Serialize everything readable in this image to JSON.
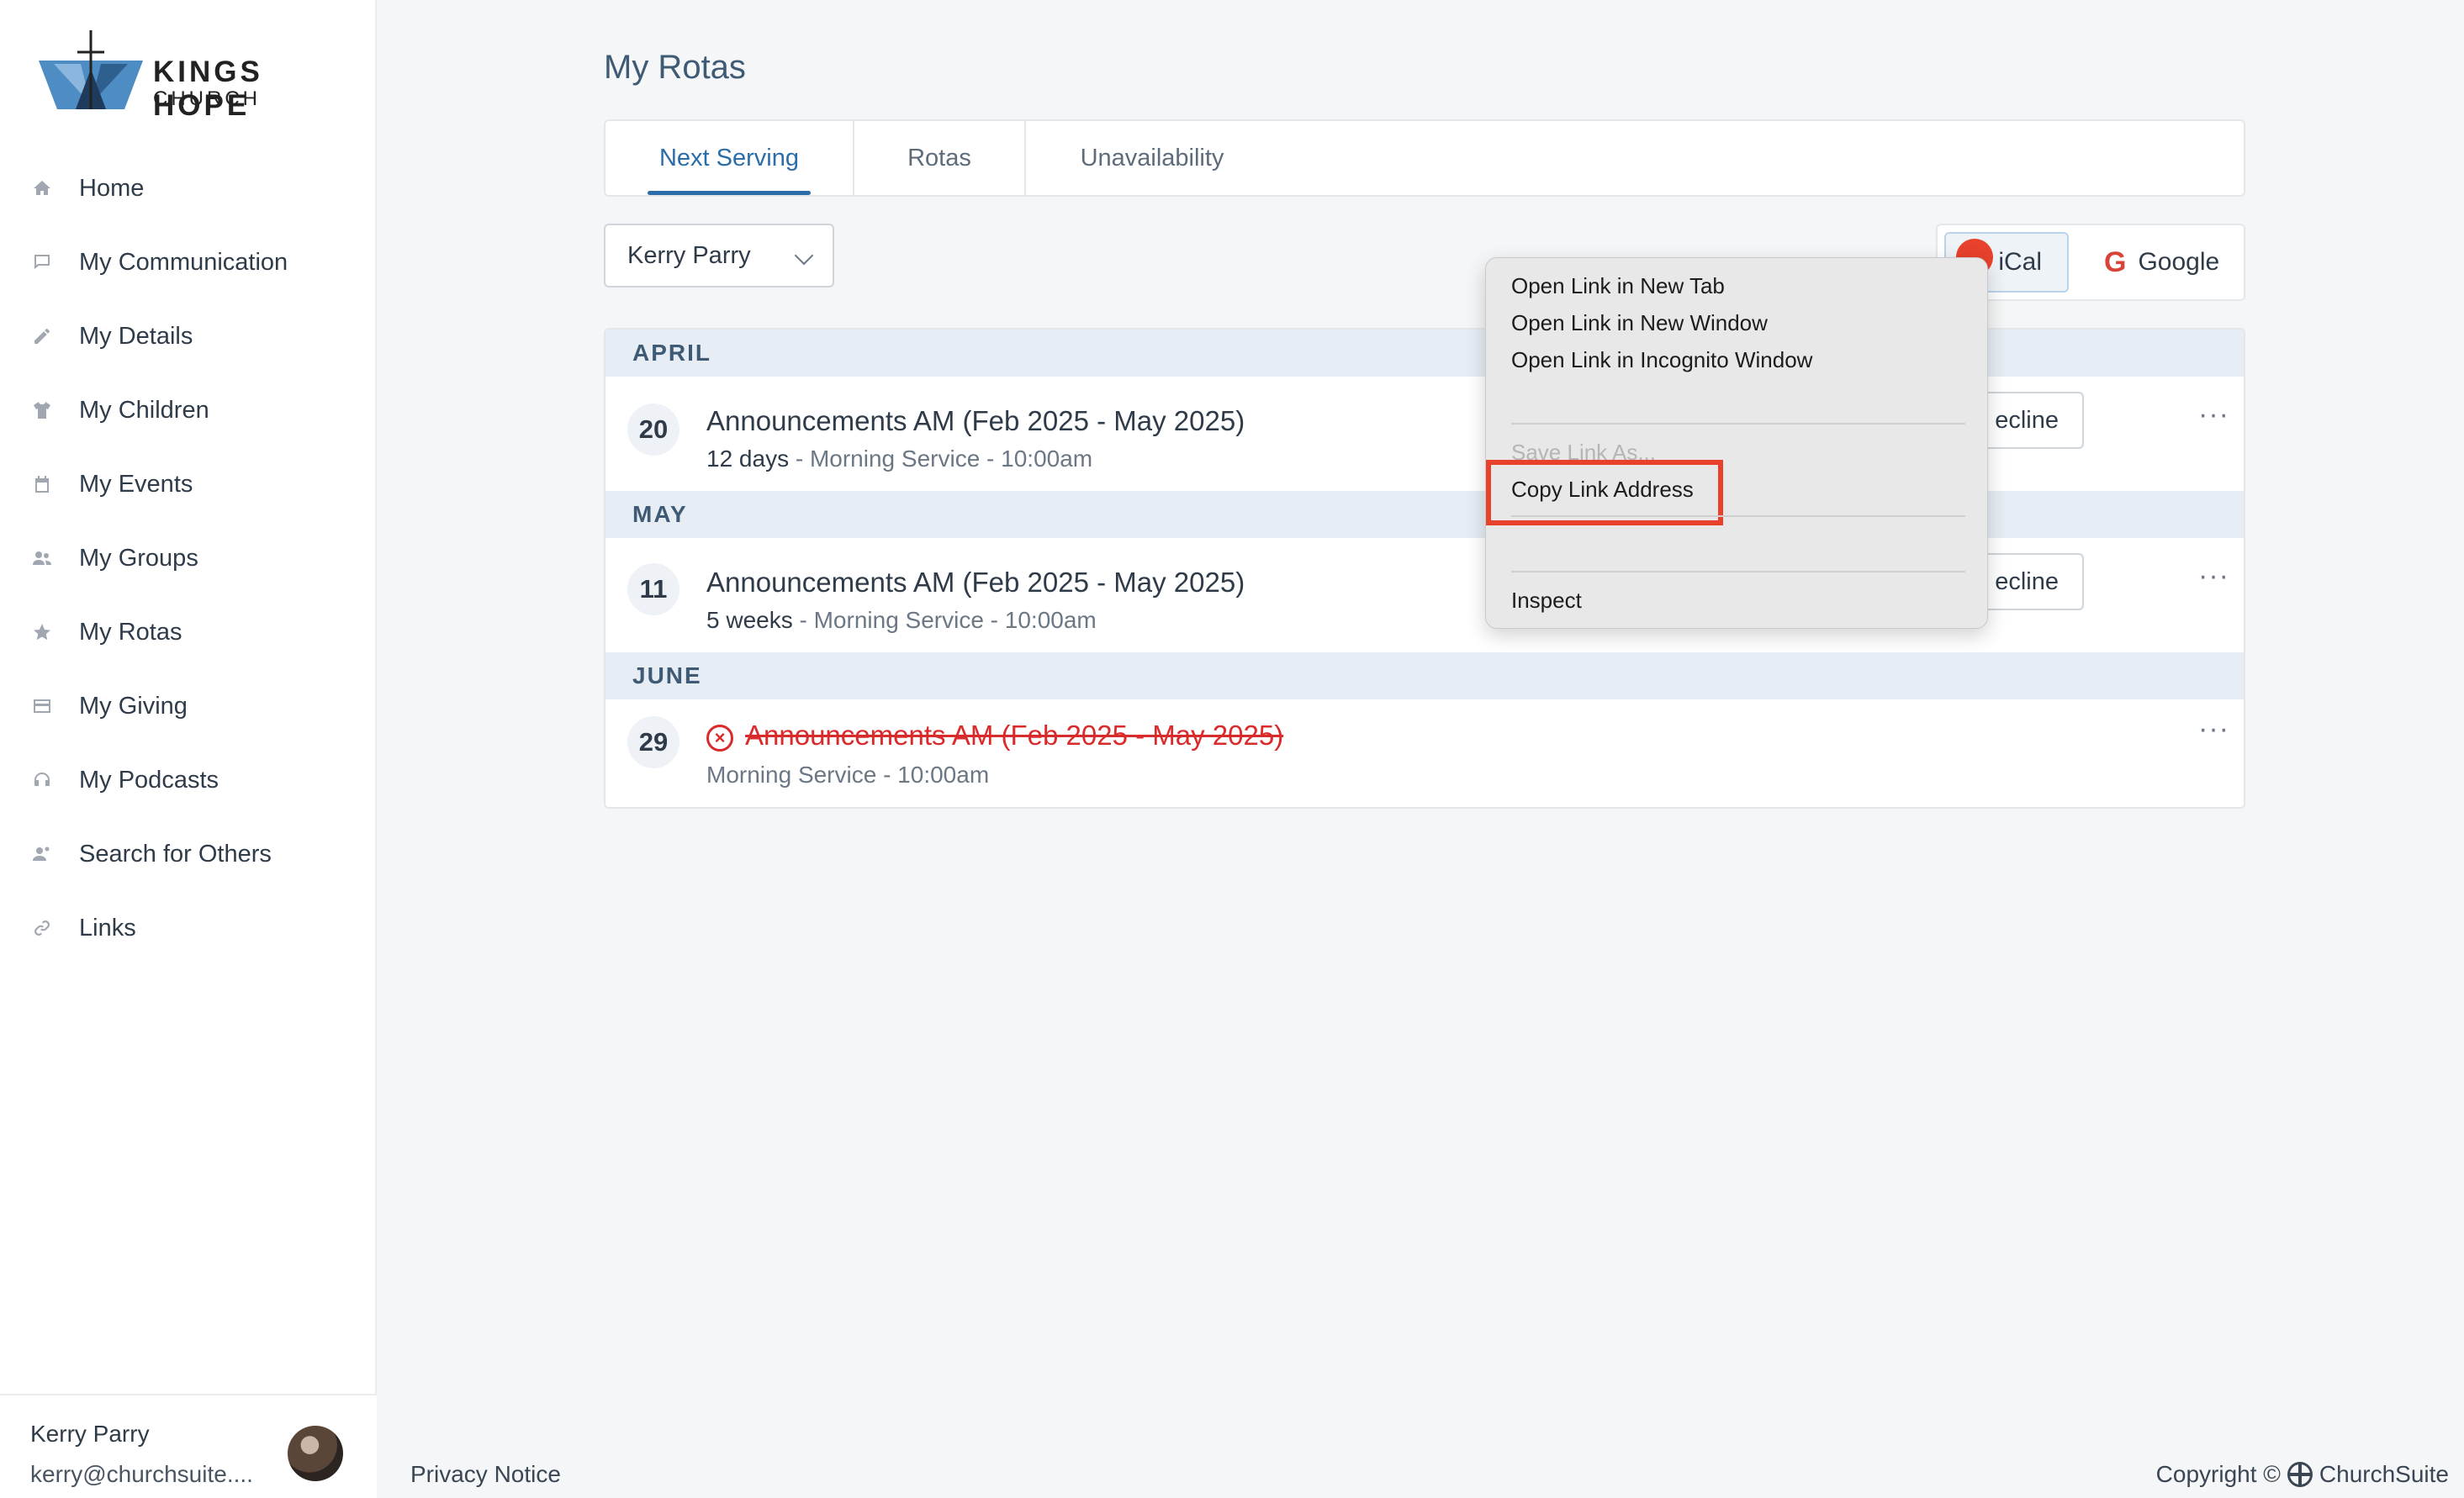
{
  "brand": {
    "line1": "KINGS HOPE",
    "line2": "CHURCH"
  },
  "sidebar": {
    "items": [
      {
        "label": "Home",
        "icon": "home-icon"
      },
      {
        "label": "My Communication",
        "icon": "chat-icon"
      },
      {
        "label": "My Details",
        "icon": "pencil-icon"
      },
      {
        "label": "My Children",
        "icon": "shirt-icon"
      },
      {
        "label": "My Events",
        "icon": "calendar-icon"
      },
      {
        "label": "My Groups",
        "icon": "users-icon"
      },
      {
        "label": "My Rotas",
        "icon": "star-icon"
      },
      {
        "label": "My Giving",
        "icon": "card-icon"
      },
      {
        "label": "My Podcasts",
        "icon": "headphones-icon"
      },
      {
        "label": "Search for Others",
        "icon": "user-search-icon"
      },
      {
        "label": "Links",
        "icon": "link-icon"
      }
    ]
  },
  "user": {
    "name": "Kerry Parry",
    "email": "kerry@churchsuite...."
  },
  "main": {
    "title": "My Rotas",
    "tabs": [
      {
        "label": "Next Serving"
      },
      {
        "label": "Rotas"
      },
      {
        "label": "Unavailability"
      }
    ],
    "person_select": "Kerry Parry",
    "ical_label": "iCal",
    "google_label": "Google",
    "months": [
      "APRIL",
      "MAY",
      "JUNE"
    ],
    "rows": [
      {
        "day": "20",
        "title": "Announcements AM (Feb 2025 - May 2025)",
        "when": "12 days",
        "detail": " - Morning Service - 10:00am",
        "action": "ecline"
      },
      {
        "day": "11",
        "title": "Announcements AM (Feb 2025 - May 2025)",
        "when": "5 weeks",
        "detail": " - Morning Service - 10:00am",
        "action": "ecline"
      },
      {
        "day": "29",
        "title": "Announcements AM (Feb 2025 - May 2025)",
        "detail": "Morning Service - 10:00am"
      }
    ],
    "more": "···"
  },
  "context_menu": {
    "items": [
      "Open Link in New Tab",
      "Open Link in New Window",
      "Open Link in Incognito Window"
    ],
    "save_link": "Save Link As...",
    "copy_link": "Copy Link Address",
    "inspect": "Inspect"
  },
  "footer": {
    "privacy": "Privacy Notice",
    "copyright": "Copyright ©",
    "company": "ChurchSuite"
  },
  "colors": {
    "accent": "#2a6da8",
    "danger": "#d92b2b",
    "highlight": "#e8412c"
  }
}
